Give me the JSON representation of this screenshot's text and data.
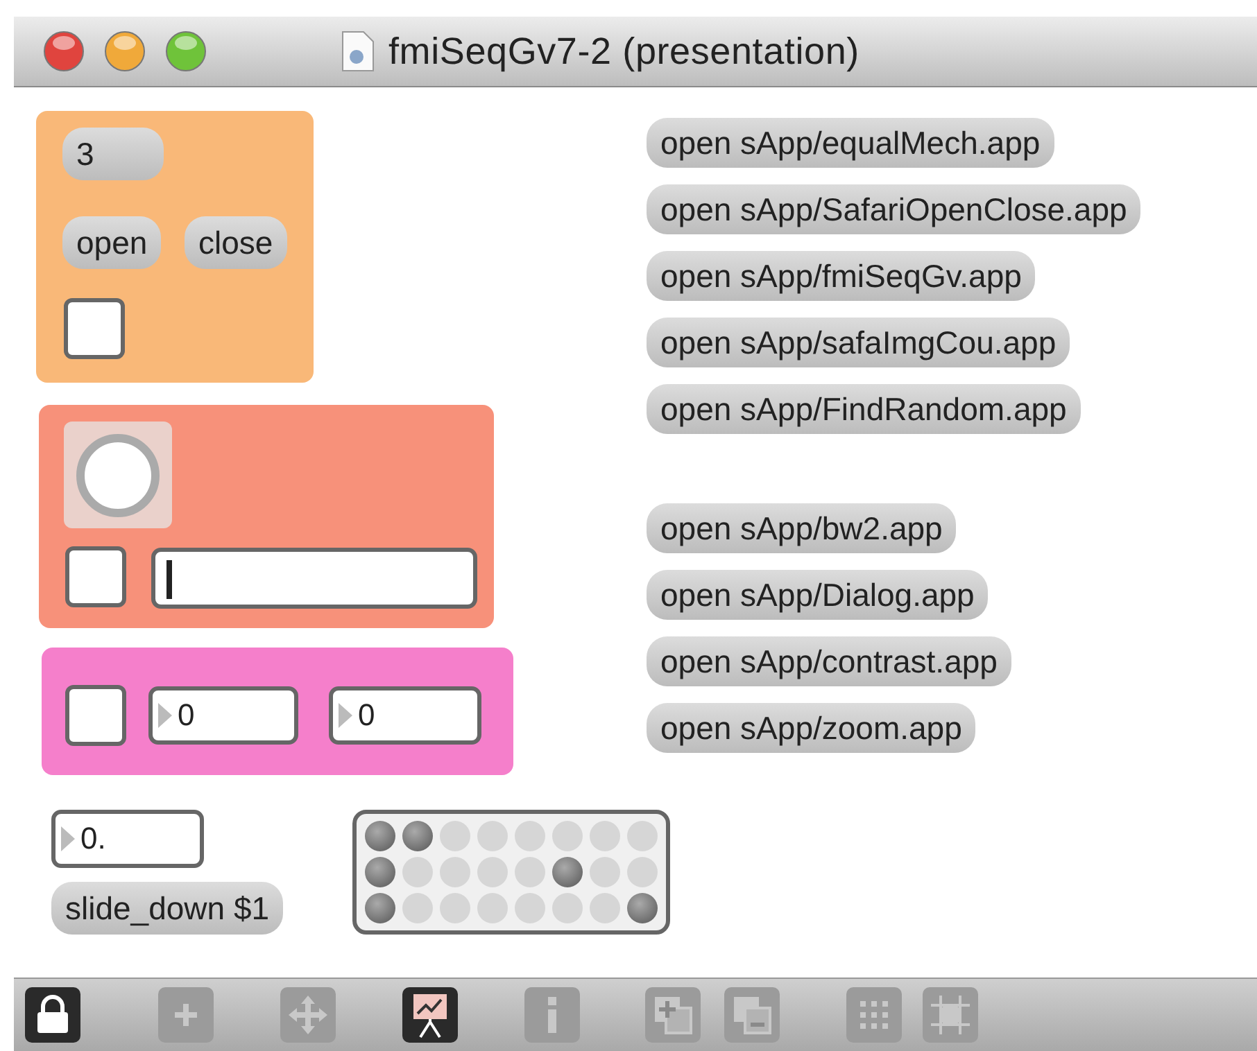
{
  "window": {
    "title": "fmiSeqGv7-2 (presentation)"
  },
  "panel_orange": {
    "number_message": "3",
    "buttons": [
      "open",
      "close"
    ],
    "toggle": {
      "checked": false
    }
  },
  "panel_salmon": {
    "bang": {
      "on": false
    },
    "toggle": {
      "checked": false
    }
  },
  "panel_pink": {
    "toggle": {
      "checked": false
    },
    "numbers": [
      "0",
      "0"
    ]
  },
  "float_number": "0.",
  "slide_message": "slide_down $1",
  "matrix": {
    "rows": [
      {
        "cells": [
          {
            "on": true
          },
          {
            "on": true
          },
          {
            "on": false
          },
          {
            "on": false
          },
          {
            "on": false
          },
          {
            "on": false
          },
          {
            "on": false
          },
          {
            "on": false
          }
        ]
      },
      {
        "cells": [
          {
            "on": true
          },
          {
            "on": false
          },
          {
            "on": false
          },
          {
            "on": false
          },
          {
            "on": false
          },
          {
            "on": true
          },
          {
            "on": false
          },
          {
            "on": false
          }
        ]
      },
      {
        "cells": [
          {
            "on": true
          },
          {
            "on": false
          },
          {
            "on": false
          },
          {
            "on": false
          },
          {
            "on": false
          },
          {
            "on": false
          },
          {
            "on": false
          },
          {
            "on": true
          }
        ]
      }
    ]
  },
  "app_message_groups": [
    [
      {
        "label": "open sApp/equalMech.app"
      },
      {
        "label": "open sApp/SafariOpenClose.app"
      },
      {
        "label": "open sApp/fmiSeqGv.app"
      },
      {
        "label": "open sApp/safaImgCou.app"
      },
      {
        "label": "open sApp/FindRandom.app"
      }
    ],
    [
      {
        "label": "open sApp/bw2.app"
      },
      {
        "label": "open sApp/Dialog.app"
      },
      {
        "label": "open sApp/contrast.app"
      },
      {
        "label": "open sApp/zoom.app"
      }
    ]
  ],
  "toolbar": [
    {
      "kind": "lock",
      "selected": true
    },
    {
      "kind": "plus",
      "selected": false
    },
    {
      "kind": "move",
      "selected": false
    },
    {
      "kind": "presentation",
      "selected": true
    },
    {
      "kind": "info",
      "selected": false
    },
    {
      "kind": "add",
      "selected": false
    },
    {
      "kind": "remove",
      "selected": false
    },
    {
      "kind": "grid",
      "selected": false
    },
    {
      "kind": "snap",
      "selected": false
    }
  ]
}
